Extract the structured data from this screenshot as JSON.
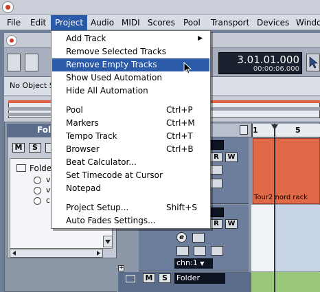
{
  "menubar": {
    "items": [
      {
        "label": "File"
      },
      {
        "label": "Edit"
      },
      {
        "label": "Project"
      },
      {
        "label": "Audio"
      },
      {
        "label": "MIDI"
      },
      {
        "label": "Scores"
      },
      {
        "label": "Pool"
      },
      {
        "label": "Transport"
      },
      {
        "label": "Devices"
      },
      {
        "label": "Windo"
      }
    ],
    "active": "Project"
  },
  "project_menu": {
    "items": [
      {
        "label": "Add Track",
        "shortcut": "",
        "submenu": "▶"
      },
      {
        "label": "Remove Selected Tracks",
        "shortcut": ""
      },
      {
        "label": "Remove Empty Tracks",
        "shortcut": "",
        "highlighted": true
      },
      {
        "label": "Show Used Automation",
        "shortcut": ""
      },
      {
        "label": "Hide All Automation",
        "shortcut": ""
      },
      {
        "label": "Pool",
        "shortcut": "Ctrl+P"
      },
      {
        "label": "Markers",
        "shortcut": "Ctrl+M"
      },
      {
        "label": "Tempo Track",
        "shortcut": "Ctrl+T"
      },
      {
        "label": "Browser",
        "shortcut": "Ctrl+B"
      },
      {
        "label": "Beat Calculator...",
        "shortcut": ""
      },
      {
        "label": "Set Timecode at Cursor",
        "shortcut": ""
      },
      {
        "label": "Notepad",
        "shortcut": ""
      },
      {
        "label": "Project Setup...",
        "shortcut": "Shift+S"
      },
      {
        "label": "Auto Fades Settings...",
        "shortcut": ""
      }
    ]
  },
  "transport": {
    "bars_beats": "3.01.01.000",
    "time": "00:00:06.000"
  },
  "info_line": {
    "text": "No Object S"
  },
  "inspector": {
    "title": "Fold",
    "mute": "M",
    "solo": "S",
    "folder_label": "Folder",
    "children": [
      "v",
      "v",
      "c"
    ]
  },
  "tracks": {
    "rec": "R",
    "write": "W",
    "chn_value": "chn:1",
    "edit_glyph": "e",
    "folder_track_name": "Folder",
    "mute": "M",
    "solo": "S"
  },
  "arrange": {
    "ruler_marks": [
      "1",
      "5"
    ],
    "event_label": "Tour2 nord rack"
  },
  "colors": {
    "menu_highlight": "#2a5aa8",
    "event_red": "#e06a48",
    "lane_green": "#9ac878"
  }
}
